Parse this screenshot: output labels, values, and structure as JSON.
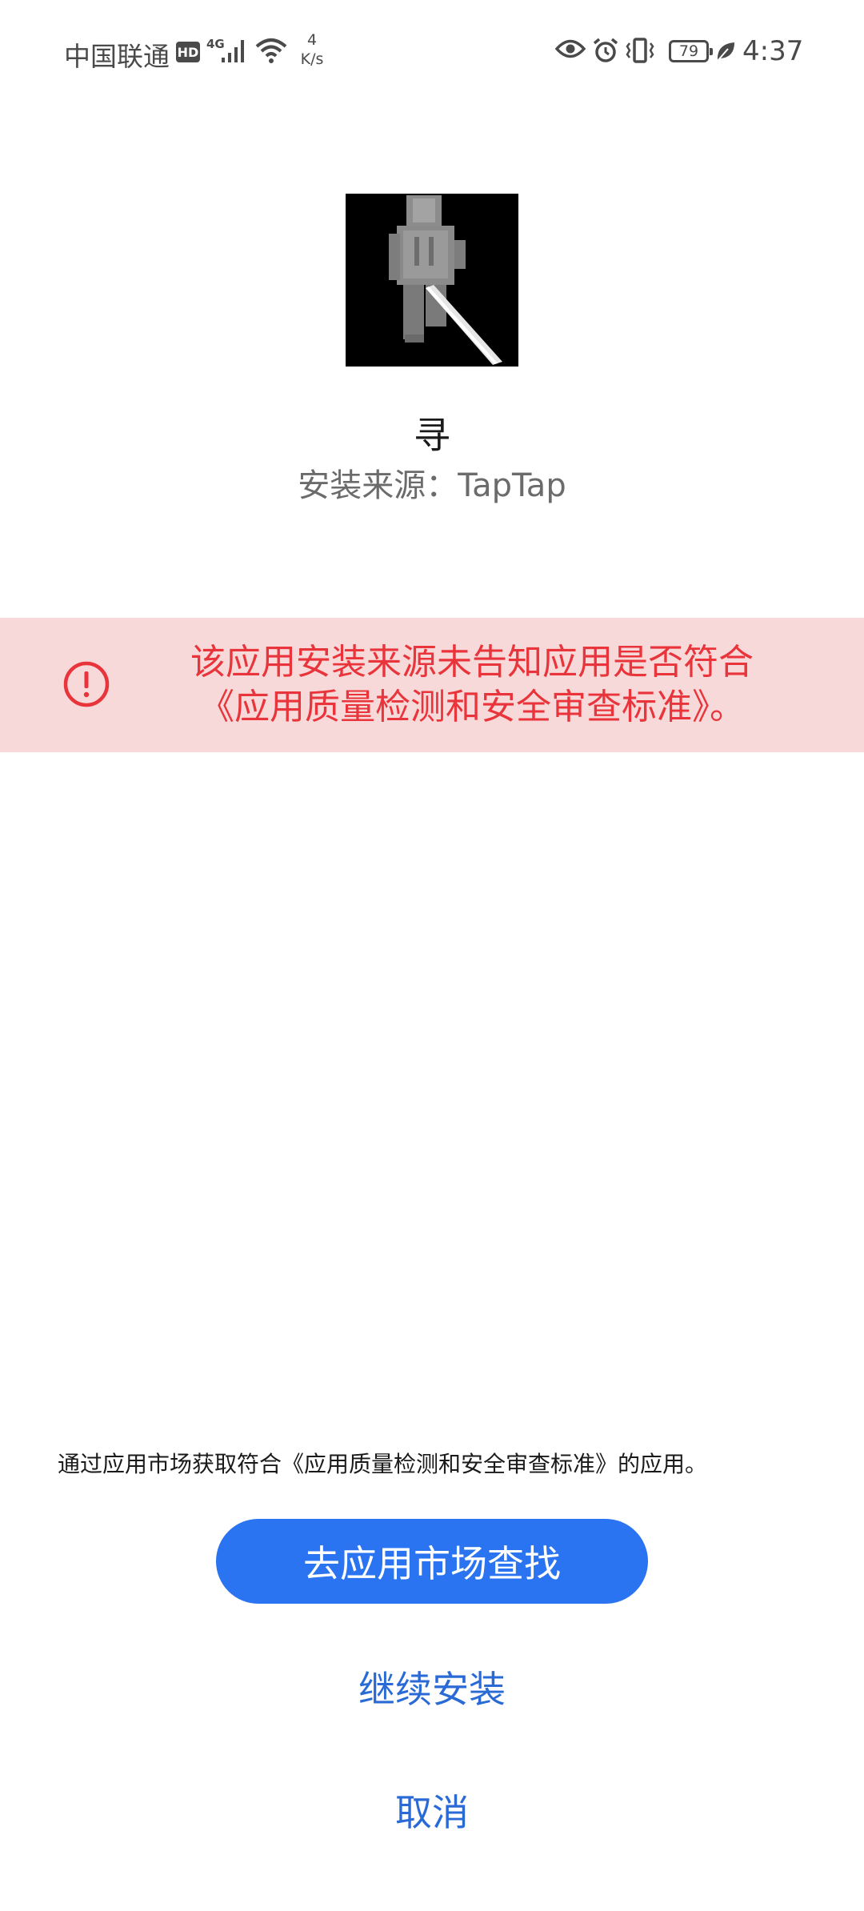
{
  "status_bar": {
    "carrier": "中国联通",
    "hd": "HD",
    "network_type": "4G",
    "speed_value": "4",
    "speed_unit": "K/s",
    "battery": "79",
    "time": "4:37"
  },
  "app": {
    "name": "寻",
    "source": "安装来源：TapTap"
  },
  "warning": {
    "line1": "该应用安装来源未告知应用是否符合",
    "line2": "《应用质量检测和安全审查标准》。",
    "color": "#e8343a",
    "background": "#f7d9d9"
  },
  "hint": "通过应用市场获取符合《应用质量检测和安全审查标准》的应用。",
  "buttons": {
    "market": "去应用市场查找",
    "continue": "继续安装",
    "cancel": "取消"
  },
  "colors": {
    "accent": "#2a74f1",
    "link": "#2a6ad6"
  }
}
